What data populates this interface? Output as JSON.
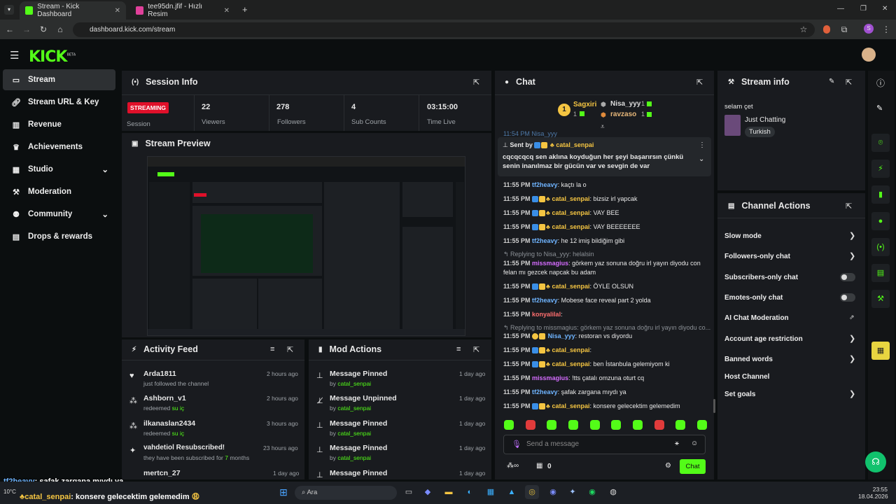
{
  "browser": {
    "tabs": [
      {
        "title": "Stream - Kick Dashboard"
      },
      {
        "title": "tee95dn.jfif - Hızlı Resim"
      }
    ],
    "url": "dashboard.kick.com/stream"
  },
  "app": {
    "logo": "KICK",
    "logo_badge": "BETA"
  },
  "sidebar": {
    "items": [
      {
        "label": "Stream"
      },
      {
        "label": "Stream URL & Key"
      },
      {
        "label": "Revenue"
      },
      {
        "label": "Achievements"
      },
      {
        "label": "Studio"
      },
      {
        "label": "Moderation"
      },
      {
        "label": "Community"
      },
      {
        "label": "Drops & rewards"
      }
    ]
  },
  "session": {
    "title": "Session Info",
    "status": "STREAMING",
    "status_label": "Session",
    "stats": [
      {
        "value": "22",
        "label": "Viewers"
      },
      {
        "value": "278",
        "label": "Followers"
      },
      {
        "value": "4",
        "label": "Sub Counts"
      },
      {
        "value": "03:15:00",
        "label": "Time Live"
      }
    ]
  },
  "preview": {
    "title": "Stream Preview"
  },
  "activity": {
    "title": "Activity Feed",
    "items": [
      {
        "name": "Arda1811",
        "desc": "just followed the channel",
        "time": "2 hours ago"
      },
      {
        "name": "Ashborn_v1",
        "desc": "redeemed ",
        "desc_hl": "su iç",
        "time": "2 hours ago"
      },
      {
        "name": "ilkanaslan2434",
        "desc": "redeemed ",
        "desc_hl": "su iç",
        "time": "3 hours ago"
      },
      {
        "name": "vahdetiol Resubscribed!",
        "desc": "they have been subscribed for ",
        "desc_hl": "7",
        "desc_tail": " months",
        "time": "23 hours ago"
      },
      {
        "name": "mertcn_27",
        "desc": "",
        "time": "1 day ago"
      }
    ]
  },
  "modactions": {
    "title": "Mod Actions",
    "items": [
      {
        "action": "Message Pinned",
        "by": "by ",
        "user": "catal_senpai",
        "time": "1 day ago"
      },
      {
        "action": "Message Unpinned",
        "by": "by ",
        "user": "catal_senpai",
        "time": "1 day ago"
      },
      {
        "action": "Message Pinned",
        "by": "by ",
        "user": "catal_senpai",
        "time": "1 day ago"
      },
      {
        "action": "Message Pinned",
        "by": "by ",
        "user": "catal_senpai",
        "time": "1 day ago"
      },
      {
        "action": "Message Pinned",
        "by": "",
        "user": "",
        "time": "1 day ago"
      }
    ]
  },
  "chat": {
    "title": "Chat",
    "leaders": [
      {
        "name": "Sagxiri",
        "count": "1",
        "rank": "1"
      },
      {
        "name": "Nisa_yyy",
        "count": "1"
      },
      {
        "name": "ravzaso",
        "count": "1"
      }
    ],
    "top_partial": "11:54 PM  Nisa_yyy",
    "pinned": {
      "sent_by": "Sent by",
      "user": "catal_senpai",
      "text": "cqcqcqcq sen aklına koyduğun her şeyi başarırsın çünkü senin inanılmaz bir gücün var ve sevgin de var"
    },
    "messages": [
      {
        "time": "11:55 PM",
        "user": "tf2heavy",
        "color": "#6fb4ff",
        "badges": 0,
        "text": "kaçtı la o"
      },
      {
        "time": "11:55 PM",
        "user": "catal_senpai",
        "color": "#f5c542",
        "badges": 3,
        "text": "bizsiz irl yapcak"
      },
      {
        "time": "11:55 PM",
        "user": "catal_senpai",
        "color": "#f5c542",
        "badges": 3,
        "text": "VAY BEE"
      },
      {
        "time": "11:55 PM",
        "user": "catal_senpai",
        "color": "#f5c542",
        "badges": 3,
        "text": "VAY BEEEEEEE"
      },
      {
        "time": "11:55 PM",
        "user": "tf2heavy",
        "color": "#6fb4ff",
        "badges": 0,
        "text": "he 12 imiş bildiğim gibi"
      }
    ],
    "reply1": "Replying to Nisa_yyy: helalsin",
    "reply_msg": {
      "time": "11:55 PM",
      "user": "missmagius",
      "color": "#d56cff",
      "text": "görkem yaz sonuna doğru irl yayın diyodu con felan mı gezcek napcak bu adam"
    },
    "messages2": [
      {
        "time": "11:55 PM",
        "user": "catal_senpai",
        "color": "#f5c542",
        "badges": 3,
        "text": "ÖYLE OLSUN"
      },
      {
        "time": "11:55 PM",
        "user": "tf2heavy",
        "color": "#6fb4ff",
        "badges": 0,
        "text": "Mobese face reveal part 2 yolda"
      },
      {
        "time": "11:55 PM",
        "user": "konyalilal",
        "color": "#ff6f6f",
        "badges": 0,
        "text": ""
      }
    ],
    "reply2": "Replying to missmagius: görkem yaz sonuna doğru irl yayın diyodu co...",
    "messages3": [
      {
        "time": "11:55 PM",
        "user": "Nisa_yyy",
        "color": "#6fb4ff",
        "badges": 2,
        "text": "restoran vs diyordu"
      },
      {
        "time": "11:55 PM",
        "user": "catal_senpai",
        "color": "#f5c542",
        "badges": 3,
        "text": ""
      },
      {
        "time": "11:55 PM",
        "user": "catal_senpai",
        "color": "#f5c542",
        "badges": 3,
        "text": "ben İstanbula gelemiyom ki"
      },
      {
        "time": "11:55 PM",
        "user": "missmagius",
        "color": "#d56cff",
        "badges": 0,
        "text": "!tts çatalı omzuna oturt cq"
      },
      {
        "time": "11:55 PM",
        "user": "tf2heavy",
        "color": "#6fb4ff",
        "badges": 0,
        "text": "şafak zargana mıydı ya"
      },
      {
        "time": "11:55 PM",
        "user": "catal_senpai",
        "color": "#f5c542",
        "badges": 3,
        "text": "konsere gelecektim gelemedim"
      }
    ],
    "input_placeholder": "Send a message",
    "points": "0",
    "send": "Chat"
  },
  "streaminfo": {
    "title": "Stream info",
    "stream_title": "selam çet",
    "category": "Just Chatting",
    "tag": "Turkish"
  },
  "channel": {
    "title": "Channel Actions",
    "items": [
      "Slow mode",
      "Followers-only chat",
      "Subscribers-only chat",
      "Emotes-only chat",
      "AI Chat Moderation",
      "Account age restriction",
      "Banned words",
      "Host Channel",
      "Set goals"
    ]
  },
  "overlay": {
    "line1_user": "tf2heavy",
    "line1_text": ": şafak zargana mıydı ya",
    "line2_user": "catal_senpai",
    "line2_text": ": konsere gelecektim gelemedim"
  },
  "taskbar": {
    "search": "Ara",
    "time": "23:55",
    "date": "18.04.2026",
    "temp": "10°C"
  },
  "colors": {
    "accent": "#53fc18",
    "panel": "#191b1f"
  }
}
